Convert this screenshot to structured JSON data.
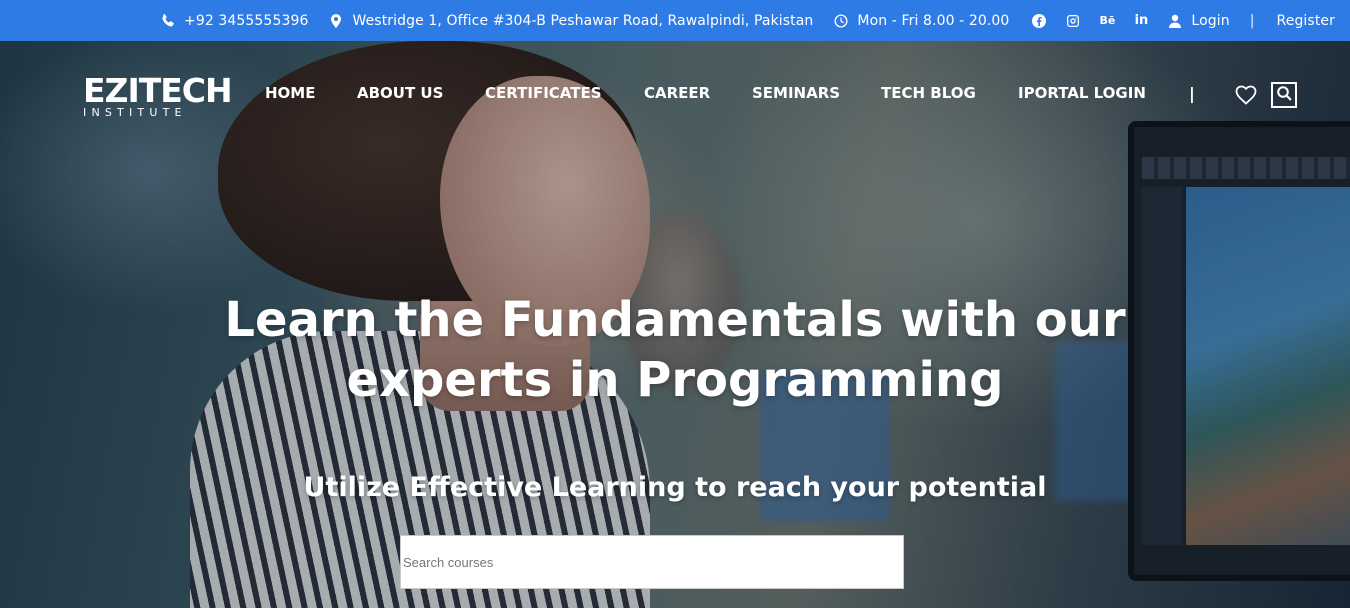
{
  "topbar": {
    "phone": "+92 3455555396",
    "address": "Westridge 1, Office #304-B Peshawar Road, Rawalpindi, Pakistan",
    "hours": "Mon - Fri 8.00 - 20.00",
    "social": [
      "facebook-icon",
      "instagram-icon",
      "behance-icon",
      "linkedin-icon"
    ],
    "behance_text": "Bē",
    "linkedin_text": "in",
    "login": "Login",
    "separator": "|",
    "register": "Register",
    "bg_color": "#2f7be6"
  },
  "logo": {
    "main": "EZITECH",
    "sub": "INSTITUTE"
  },
  "nav": {
    "items": [
      "HOME",
      "ABOUT US",
      "CERTIFICATES",
      "CAREER",
      "SEMINARS",
      "TECH BLOG",
      "IPORTAL LOGIN"
    ],
    "separator": "|"
  },
  "hero": {
    "headline_line1": "Learn the Fundamentals with our",
    "headline_line2": "experts in Programming",
    "subheadline": "Utilize Effective Learning to reach your potential",
    "search_placeholder": "Search courses"
  }
}
